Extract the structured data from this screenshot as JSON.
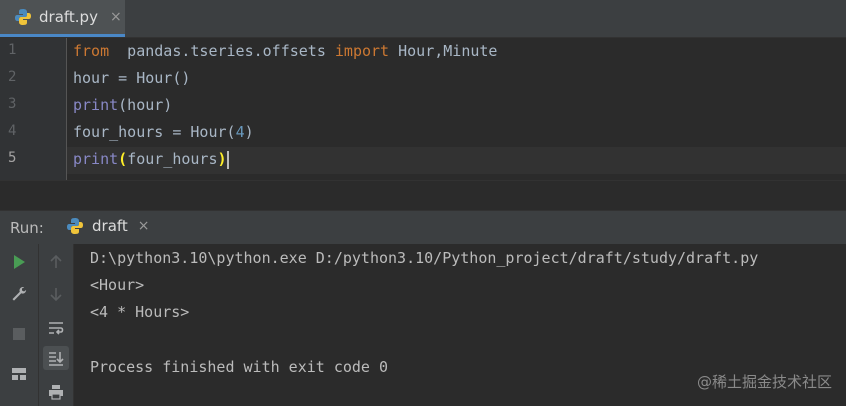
{
  "editor_tab": {
    "label": "draft.py",
    "close": "×",
    "icon": "python-file-icon"
  },
  "editor": {
    "line_numbers": [
      "1",
      "2",
      "3",
      "4",
      "5"
    ],
    "lines": [
      {
        "t1": "from",
        "t2": "  pandas.tseries.offsets ",
        "t3": "import",
        "t4": " Hour,Minute"
      },
      {
        "t1": "hour = Hour()"
      },
      {
        "t1": "print",
        "t2": "(hour)"
      },
      {
        "t1": "four_hours = Hour(",
        "t2": "4",
        "t3": ")"
      },
      {
        "t1": "print",
        "t2": "(",
        "t3": "four_hours",
        "t4": ")"
      }
    ]
  },
  "run_panel": {
    "label": "Run:",
    "tab_label": "draft",
    "tab_close": "×",
    "output": [
      "D:\\python3.10\\python.exe D:/python3.10/Python_project/draft/study/draft.py",
      "<Hour>",
      "<4 * Hours>",
      "",
      "Process finished with exit code 0"
    ]
  },
  "watermark": "@稀土掘金技术社区",
  "colors": {
    "keyword": "#cc7832",
    "builtin": "#8888c6",
    "number": "#6897bb",
    "text": "#a9b7c6",
    "accent": "#4a88c7",
    "run_green": "#499c54"
  }
}
